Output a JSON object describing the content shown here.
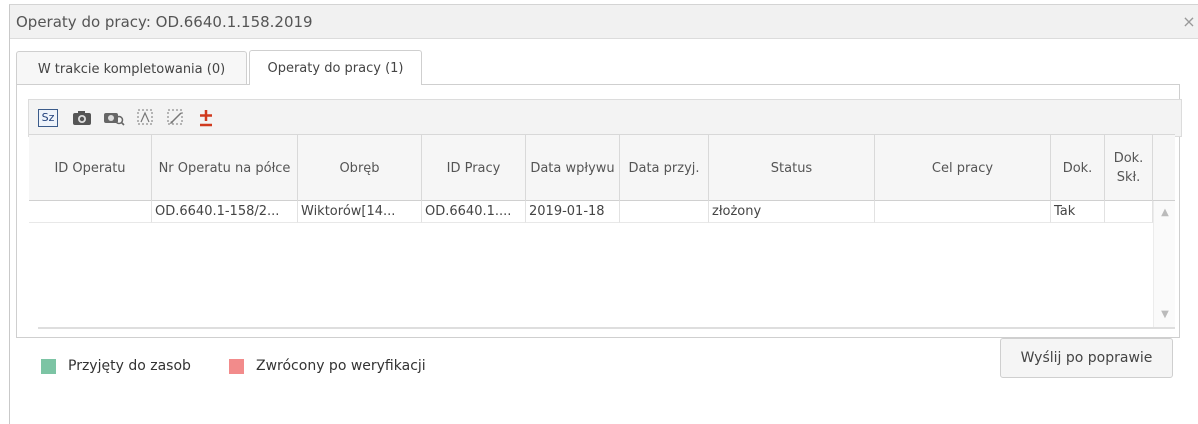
{
  "window": {
    "title": "Operaty do pracy: OD.6640.1.158.2019",
    "close_label": "×"
  },
  "tabs": [
    {
      "label": "W trakcie kompletowania (0)"
    },
    {
      "label": "Operaty do pracy (1)"
    }
  ],
  "toolbar": {
    "buttons": [
      {
        "label": "Sz",
        "icon": "sz-icon"
      },
      {
        "icon": "camera-icon"
      },
      {
        "icon": "camera-search-icon"
      },
      {
        "icon": "select-area-icon"
      },
      {
        "icon": "edit-selection-icon"
      },
      {
        "icon": "plus-minus-icon"
      }
    ]
  },
  "grid": {
    "columns": [
      "ID Operatu",
      "Nr Operatu na półce",
      "Obręb",
      "ID Pracy",
      "Data wpływu",
      "Data przyj.",
      "Status",
      "Cel pracy",
      "Dok.",
      "Dok. Skł."
    ],
    "rows": [
      {
        "id_operatu": "",
        "nr_operatu": "OD.6640.1-158/2...",
        "obreb": "Wiktorów[14...",
        "id_pracy": "OD.6640.1....",
        "data_wplywu": "2019-01-18",
        "data_przyj": "",
        "status": "złożony",
        "cel_pracy": "",
        "dok": "Tak",
        "dok_skl": ""
      }
    ]
  },
  "legend": [
    {
      "label": "Przyjęty do zasob",
      "color": "#7cc4a4"
    },
    {
      "label": "Zwrócony po weryfikacji",
      "color": "#f28b8b"
    }
  ],
  "actions": {
    "send_label": "Wyślij po poprawie"
  }
}
